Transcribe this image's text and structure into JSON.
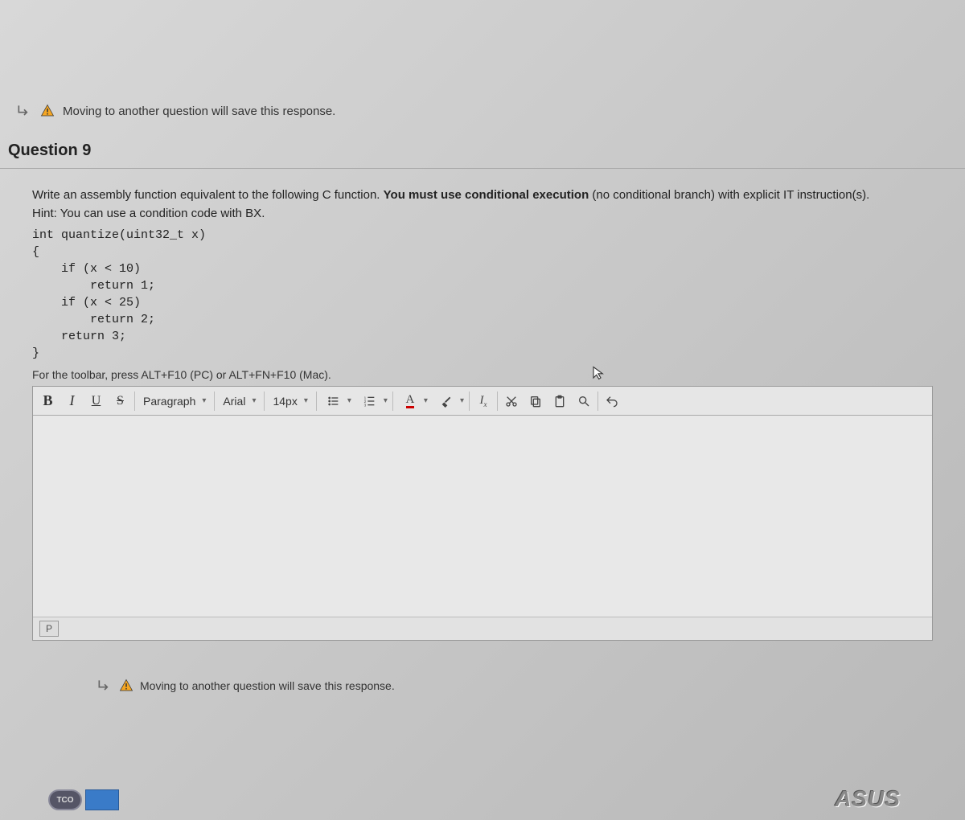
{
  "notice": {
    "text": "Moving to another question will save this response."
  },
  "question": {
    "title": "Question 9",
    "prompt_lead": "Write an assembly function equivalent to the following C function. ",
    "prompt_bold": "You must use conditional execution",
    "prompt_trail": " (no conditional branch) with explicit IT instruction(s).",
    "hint": "Hint: You can use a condition code with BX.",
    "code": "int quantize(uint32_t x)\n{\n    if (x < 10)\n        return 1;\n    if (x < 25)\n        return 2;\n    return 3;\n}",
    "toolbar_hint": "For the toolbar, press ALT+F10 (PC) or ALT+FN+F10 (Mac)."
  },
  "editor": {
    "bold": "B",
    "italic": "I",
    "underline": "U",
    "strike": "S",
    "paragraph": "Paragraph",
    "font": "Arial",
    "size": "14px",
    "text_color": "A",
    "clear_fmt": "Tx",
    "footer_p": "P"
  },
  "brand": {
    "monitor": "ASUS",
    "sticker": "TCO"
  }
}
